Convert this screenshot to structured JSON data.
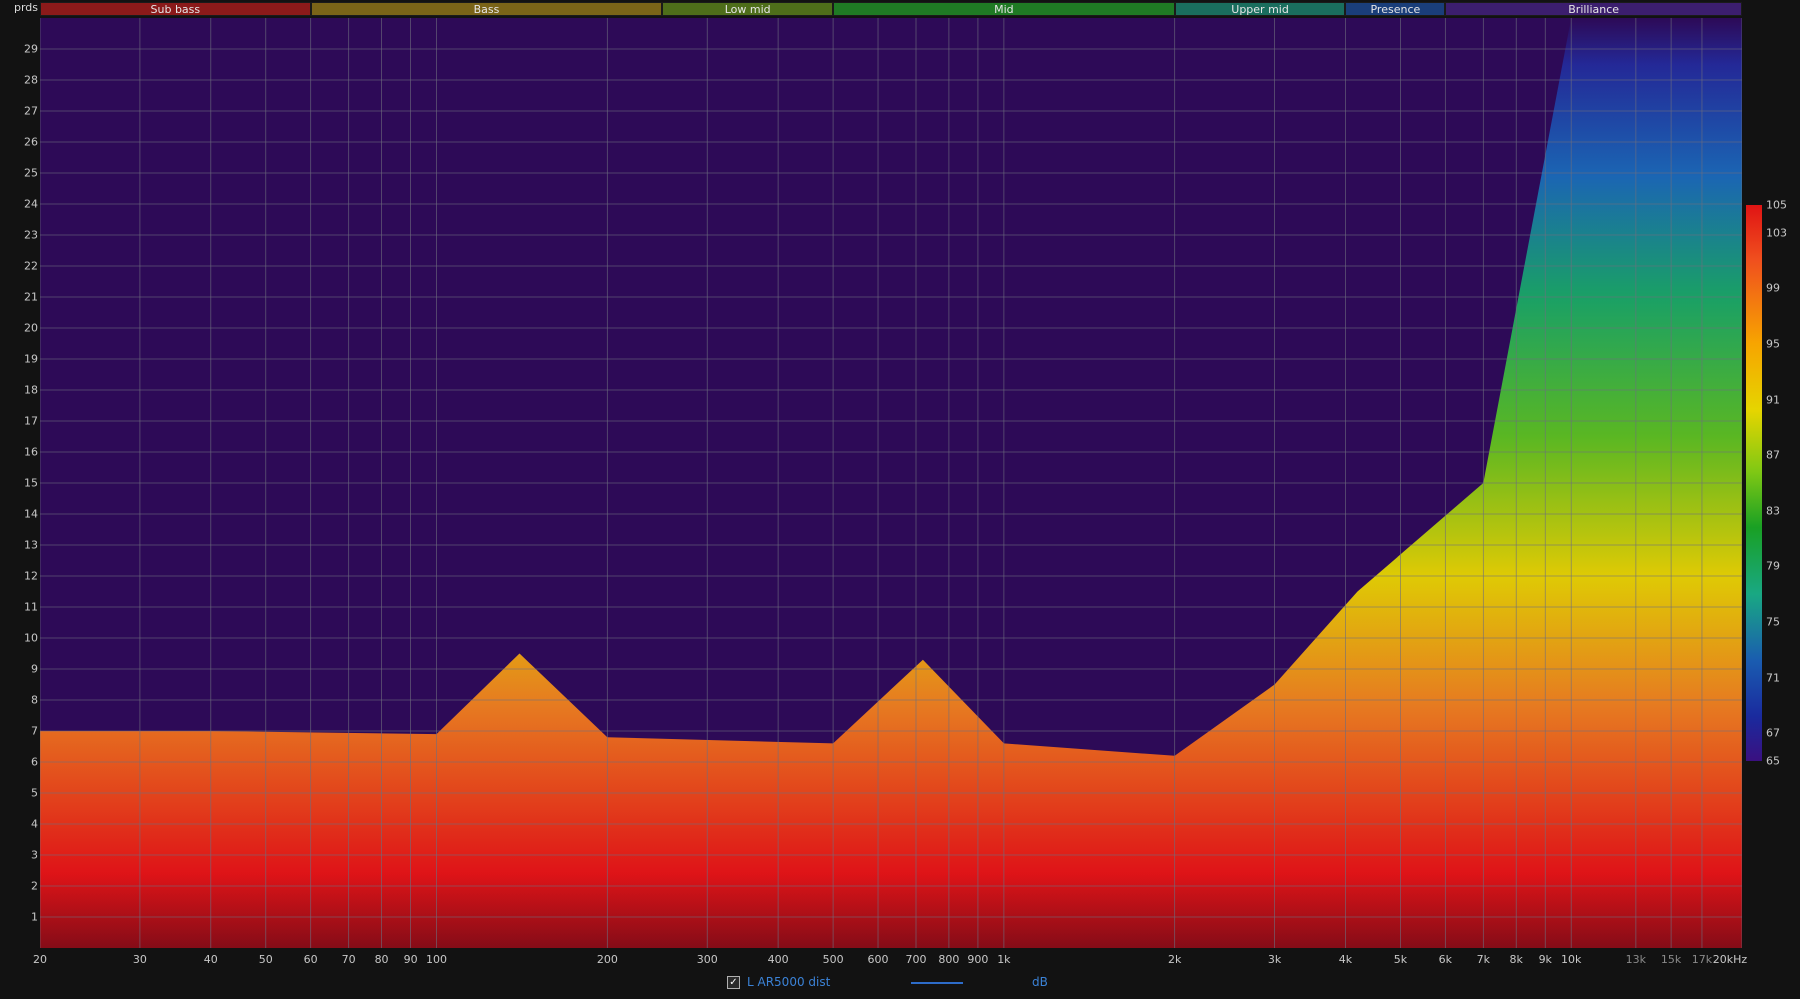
{
  "chart_data": {
    "type": "heatmap",
    "title": "",
    "xlabel": "",
    "ylabel": "prds",
    "x_unit": "kHz",
    "x_scale": "log",
    "xlim": [
      20,
      20000
    ],
    "ylim": [
      0,
      30
    ],
    "grid": true,
    "x_ticks": [
      {
        "value": 20,
        "label": "20"
      },
      {
        "value": 30,
        "label": "30"
      },
      {
        "value": 40,
        "label": "40"
      },
      {
        "value": 50,
        "label": "50"
      },
      {
        "value": 60,
        "label": "60"
      },
      {
        "value": 70,
        "label": "70"
      },
      {
        "value": 80,
        "label": "80"
      },
      {
        "value": 90,
        "label": "90"
      },
      {
        "value": 100,
        "label": "100"
      },
      {
        "value": 200,
        "label": "200"
      },
      {
        "value": 300,
        "label": "300"
      },
      {
        "value": 400,
        "label": "400"
      },
      {
        "value": 500,
        "label": "500"
      },
      {
        "value": 600,
        "label": "600"
      },
      {
        "value": 700,
        "label": "700"
      },
      {
        "value": 800,
        "label": "800"
      },
      {
        "value": 900,
        "label": "900"
      },
      {
        "value": 1000,
        "label": "1k"
      },
      {
        "value": 2000,
        "label": "2k"
      },
      {
        "value": 3000,
        "label": "3k"
      },
      {
        "value": 4000,
        "label": "4k"
      },
      {
        "value": 5000,
        "label": "5k"
      },
      {
        "value": 6000,
        "label": "6k"
      },
      {
        "value": 7000,
        "label": "7k"
      },
      {
        "value": 8000,
        "label": "8k"
      },
      {
        "value": 9000,
        "label": "9k"
      },
      {
        "value": 10000,
        "label": "10k"
      },
      {
        "value": 13000,
        "label": "13k",
        "minor": true
      },
      {
        "value": 15000,
        "label": "15k",
        "minor": true
      },
      {
        "value": 17000,
        "label": "17k",
        "minor": true
      },
      {
        "value": 20000,
        "label": "20kHz"
      }
    ],
    "y_ticks": [
      1,
      2,
      3,
      4,
      5,
      6,
      7,
      8,
      9,
      10,
      11,
      12,
      13,
      14,
      15,
      16,
      17,
      18,
      19,
      20,
      21,
      22,
      23,
      24,
      25,
      26,
      27,
      28,
      29
    ],
    "bands": [
      {
        "name": "Sub bass",
        "from": 20,
        "to": 60,
        "color": "#8b1a1a"
      },
      {
        "name": "Bass",
        "from": 60,
        "to": 250,
        "color": "#7a6418"
      },
      {
        "name": "Low mid",
        "from": 250,
        "to": 500,
        "color": "#4e6e1a"
      },
      {
        "name": "Mid",
        "from": 500,
        "to": 2000,
        "color": "#1f7a24"
      },
      {
        "name": "Upper mid",
        "from": 2000,
        "to": 4000,
        "color": "#1a6e5e"
      },
      {
        "name": "Presence",
        "from": 4000,
        "to": 6000,
        "color": "#1a3e7a"
      },
      {
        "name": "Brilliance",
        "from": 6000,
        "to": 20000,
        "color": "#3c1e6e"
      }
    ],
    "colorbar": {
      "unit": "dB",
      "min": 65,
      "max": 105,
      "ticks": [
        105,
        103,
        99,
        95,
        91,
        87,
        83,
        79,
        75,
        71,
        67,
        65
      ]
    },
    "low_band_ridge": [
      {
        "freq": 20,
        "top": 7.0
      },
      {
        "freq": 40,
        "top": 7.0
      },
      {
        "freq": 100,
        "top": 6.9
      },
      {
        "freq": 140,
        "top": 9.5
      },
      {
        "freq": 200,
        "top": 6.8
      },
      {
        "freq": 500,
        "top": 6.6
      },
      {
        "freq": 720,
        "top": 9.3
      },
      {
        "freq": 1000,
        "top": 6.6
      },
      {
        "freq": 2000,
        "top": 6.2
      },
      {
        "freq": 3000,
        "top": 8.5
      },
      {
        "freq": 4200,
        "top": 11.5
      },
      {
        "freq": 7000,
        "top": 15.0
      },
      {
        "freq": 10000,
        "top": 30.0
      },
      {
        "freq": 20000,
        "top": 30.0
      }
    ]
  },
  "legend": {
    "checked": true,
    "check_glyph": "✓",
    "series_label": "L AR5000 dist",
    "series_color": "#2d6cc9",
    "unit_label": "dB"
  }
}
